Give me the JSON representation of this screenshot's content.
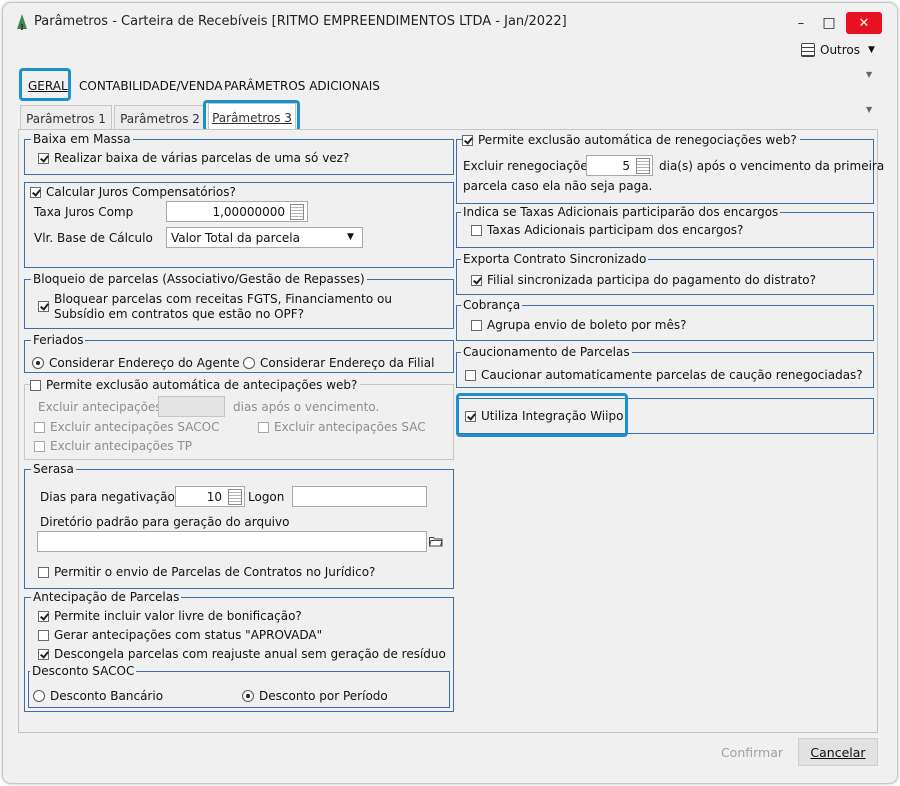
{
  "window": {
    "title": "Parâmetros - Carteira de Recebíveis [RITMO EMPREENDIMENTOS LTDA - Jan/2022]",
    "minimize": "–",
    "maximize": "□",
    "close": "✕",
    "outros": "Outros"
  },
  "main_tabs": [
    "GERAL",
    "CONTABILIDADE/VENDA",
    "PARÂMETROS ADICIONAIS"
  ],
  "sub_tabs": [
    "Parâmetros 1",
    "Parâmetros 2",
    "Parâmetros 3"
  ],
  "left": {
    "baixa": {
      "title": "Baixa em Massa",
      "opt": "Realizar baixa de várias parcelas de uma só vez?"
    },
    "juros": {
      "title": "Calcular Juros Compensatórios?",
      "taxa_label": "Taxa Juros Comp",
      "taxa_value": "1,00000000",
      "base_label": "Vlr. Base de Cálculo",
      "base_value": "Valor Total da parcela"
    },
    "bloqueio": {
      "title": "Bloqueio de parcelas (Associativo/Gestão de Repasses)",
      "line1": "Bloquear parcelas com receitas FGTS, Financiamento ou",
      "line2": "Subsídio em contratos que estão no OPF?"
    },
    "feriados": {
      "title": "Feriados",
      "opt1": "Considerar Endereço do Agente",
      "opt2": "Considerar Endereço da Filial"
    },
    "antecip_web": {
      "title": "Permite exclusão automática de antecipações web?",
      "excluir_label": "Excluir antecipações",
      "excluir_suffix": "dias após o vencimento.",
      "sacoc": "Excluir antecipações SACOC",
      "sac": "Excluir antecipações SAC",
      "tp": "Excluir antecipações TP"
    },
    "serasa": {
      "title": "Serasa",
      "dias_label": "Dias para negativação",
      "dias_value": "10",
      "logon_label": "Logon",
      "dir_label": "Diretório padrão para geração do arquivo",
      "juridico": "Permitir o envio de Parcelas de Contratos no Jurídico?"
    },
    "antecipacao": {
      "title": "Antecipação de Parcelas",
      "opt1": "Permite incluir valor livre de bonificação?",
      "opt2": "Gerar antecipações com status \"APROVADA\"",
      "opt3": "Descongela parcelas com reajuste anual sem geração de resíduo",
      "sacoc_title": "Desconto SACOC",
      "sacoc_opt1": "Desconto Bancário",
      "sacoc_opt2": "Desconto por Período"
    }
  },
  "right": {
    "reneg": {
      "title": "Permite exclusão automática de renegociações web?",
      "excluir_label": "Excluir renegociações",
      "excluir_value": "5",
      "suffix1": "dia(s) após o vencimento da primeira",
      "suffix2": "parcela caso ela não seja paga."
    },
    "taxas": {
      "title": "Indica se Taxas Adicionais participarão dos encargos",
      "opt": "Taxas Adicionais participam dos encargos?"
    },
    "exporta": {
      "title": "Exporta Contrato Sincronizado",
      "opt": "Filial sincronizada participa do pagamento do distrato?"
    },
    "cobranca": {
      "title": "Cobrança",
      "opt": "Agrupa envio de boleto por mês?"
    },
    "caucion": {
      "title": "Caucionamento de Parcelas",
      "opt": "Caucionar automaticamente parcelas de caução renegociadas?"
    },
    "wiipo": {
      "opt": "Utiliza Integração Wiipo"
    }
  },
  "footer": {
    "confirmar": "Confirmar",
    "cancelar": "Cancelar"
  },
  "colors": {
    "highlight": "#1c8fce",
    "group_border": "#3c6ea7",
    "close_red": "#e81123"
  }
}
